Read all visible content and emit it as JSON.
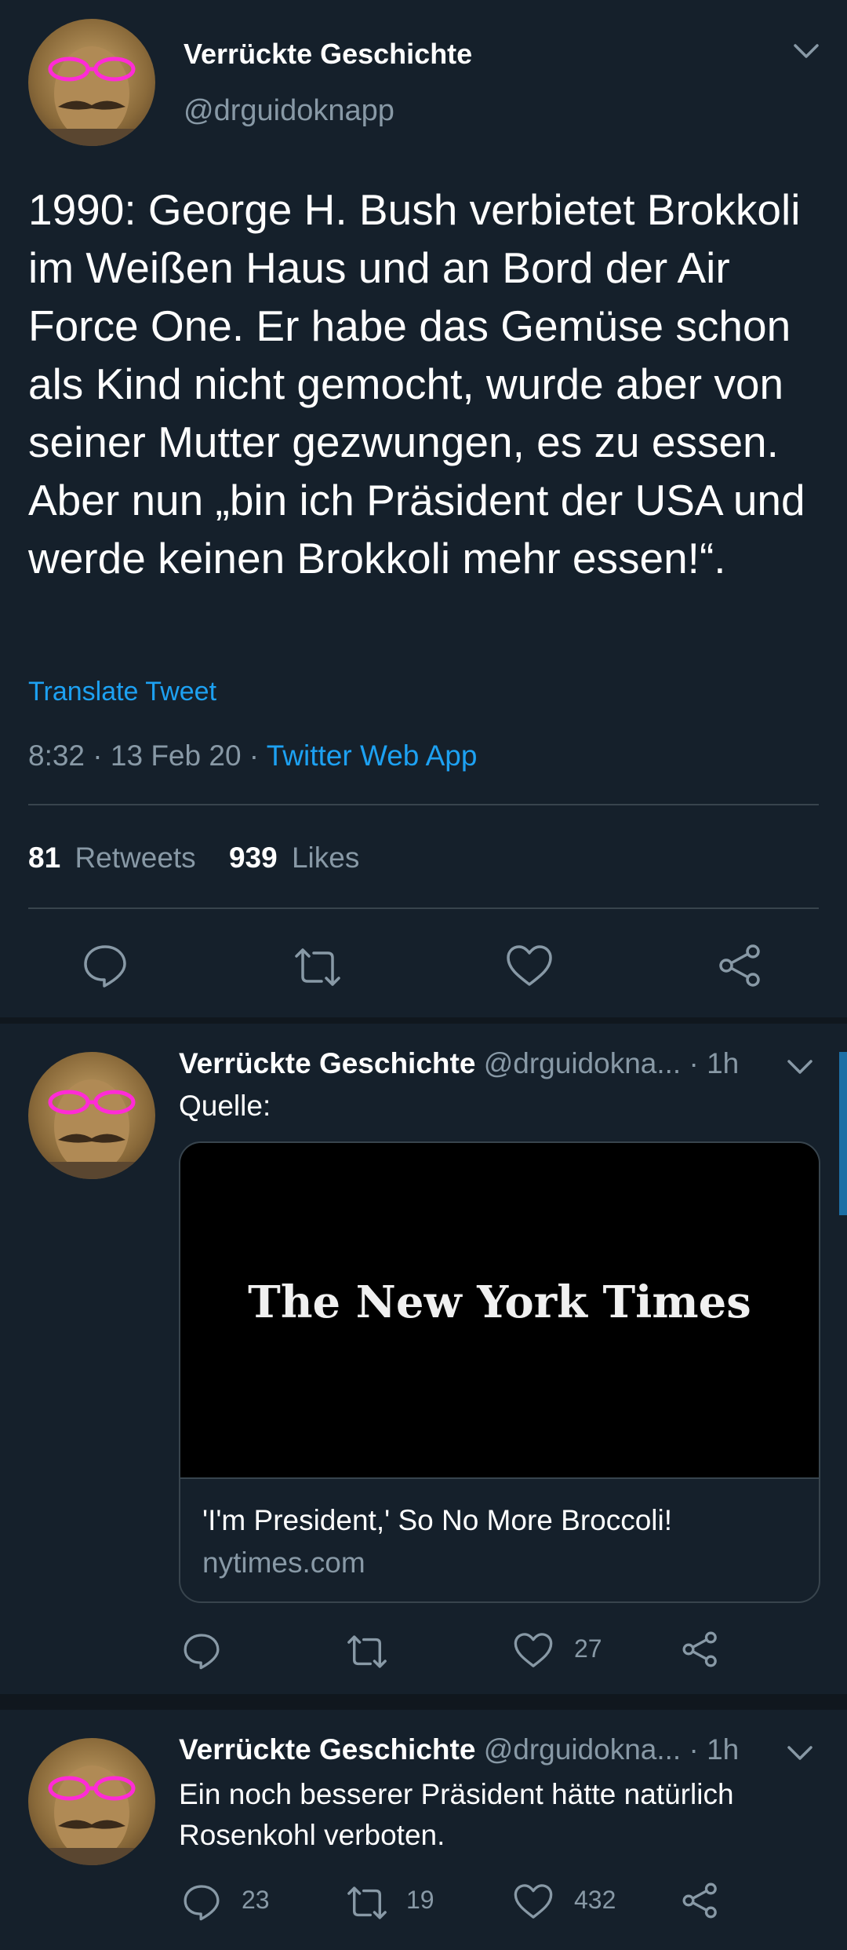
{
  "main_tweet": {
    "display_name": "Verrückte Geschichte",
    "handle": "@drguidoknapp",
    "text": "1990: George H. Bush verbietet Brokkoli im Weißen Haus und an Bord der Air Force One. Er habe das Gemüse schon als Kind nicht gemocht, wurde aber von seiner Mutter gezwungen, es zu essen. Aber nun „bin ich Präsident der USA und werde keinen Brokkoli mehr essen!“.",
    "translate_label": "Translate Tweet",
    "time": "8:32 · 13 Feb 20 · ",
    "source": "Twitter Web App",
    "retweet_count": "81",
    "retweet_label": "Retweets",
    "like_count": "939",
    "like_label": "Likes"
  },
  "reply1": {
    "display_name": "Verrückte Geschichte",
    "handle_time": "@drguidokna... · 1h",
    "text": "Quelle:",
    "card": {
      "logo_text": "The New York Times",
      "title": "'I'm President,' So No More Broccoli!",
      "domain": "nytimes.com"
    },
    "like_count": "27"
  },
  "reply2": {
    "display_name": "Verrückte Geschichte",
    "handle_time": "@drguidokna... · 1h",
    "text": "Ein noch besserer Präsident hätte natürlich Rosenkohl verboten.",
    "reply_count": "23",
    "retweet_count": "19",
    "like_count": "432"
  },
  "colors": {
    "background": "#15202b",
    "accent": "#1da1f2",
    "muted": "#8899a6",
    "divider": "#38444d"
  }
}
